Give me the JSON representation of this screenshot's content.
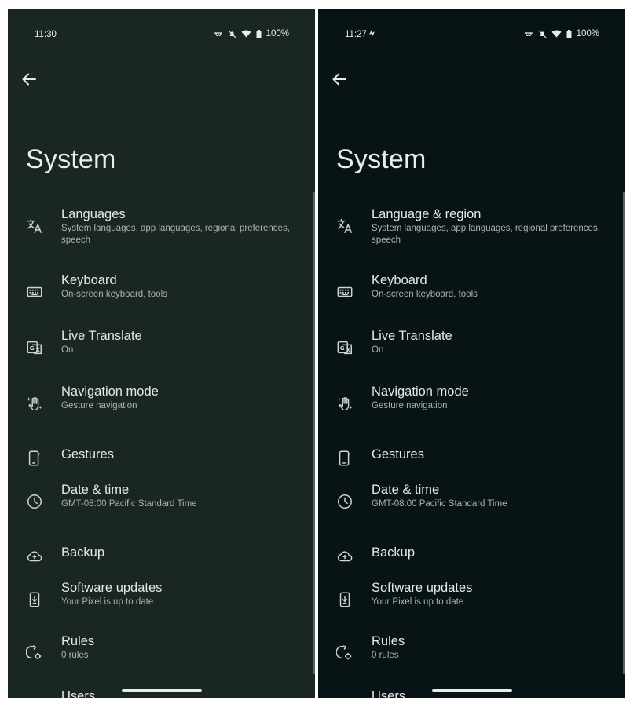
{
  "left": {
    "status": {
      "time": "11:30",
      "battery": "100%"
    },
    "title": "System",
    "items": [
      {
        "label": "Languages",
        "sub": "System languages, app languages, regional preferences, speech"
      },
      {
        "label": "Keyboard",
        "sub": "On-screen keyboard, tools"
      },
      {
        "label": "Live Translate",
        "sub": "On"
      },
      {
        "label": "Navigation mode",
        "sub": "Gesture navigation"
      },
      {
        "label": "Gestures",
        "sub": ""
      },
      {
        "label": "Date & time",
        "sub": "GMT-08:00 Pacific Standard Time"
      },
      {
        "label": "Backup",
        "sub": ""
      },
      {
        "label": "Software updates",
        "sub": "Your Pixel is up to date"
      },
      {
        "label": "Rules",
        "sub": "0 rules"
      },
      {
        "label": "Users",
        "sub": ""
      }
    ]
  },
  "right": {
    "status": {
      "time": "11:27",
      "battery": "100%"
    },
    "title": "System",
    "items": [
      {
        "label": "Language & region",
        "sub": "System languages, app languages, regional preferences, speech"
      },
      {
        "label": "Keyboard",
        "sub": "On-screen keyboard, tools"
      },
      {
        "label": "Live Translate",
        "sub": "On"
      },
      {
        "label": "Navigation mode",
        "sub": "Gesture navigation"
      },
      {
        "label": "Gestures",
        "sub": ""
      },
      {
        "label": "Date & time",
        "sub": "GMT-08:00 Pacific Standard Time"
      },
      {
        "label": "Backup",
        "sub": ""
      },
      {
        "label": "Software updates",
        "sub": "Your Pixel is up to date"
      },
      {
        "label": "Rules",
        "sub": "0 rules"
      },
      {
        "label": "Users",
        "sub": ""
      }
    ]
  },
  "icons": [
    "translate-icon",
    "keyboard-icon",
    "live-translate-icon",
    "gesture-hand-icon",
    "phone-gesture-icon",
    "clock-icon",
    "cloud-upload-icon",
    "system-update-icon",
    "rules-icon",
    "users-icon"
  ],
  "colors": {
    "left_bg": "#1a2624",
    "right_bg": "#071315",
    "text": "#e3e8e6",
    "subtext": "#a9b3b0"
  }
}
